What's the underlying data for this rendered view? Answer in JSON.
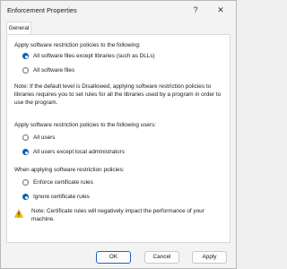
{
  "window": {
    "title": "Enforcement Properties",
    "help_glyph": "?",
    "close_glyph": "✕"
  },
  "tabs": [
    {
      "label": "General"
    }
  ],
  "section1": {
    "heading": "Apply software restriction policies to the following:",
    "options": [
      {
        "label": "All software files except libraries (such as DLLs)",
        "selected": true
      },
      {
        "label": "All software files",
        "selected": false
      }
    ]
  },
  "note": "Note:  If the default level is Disallowed, applying software restriction policies to libraries requires you to set rules for all the libraries used by a program in order to use the program.",
  "section2": {
    "heading": "Apply software restriction policies to the following users:",
    "options": [
      {
        "label": "All users",
        "selected": false
      },
      {
        "label": "All users except local administrators",
        "selected": true
      }
    ]
  },
  "section3": {
    "heading": "When applying software restriction policies:",
    "options": [
      {
        "label": "Enforce certificate rules",
        "selected": false
      },
      {
        "label": "Ignore certificate rules",
        "selected": true
      }
    ]
  },
  "warning": {
    "icon": "warning-icon",
    "text": "Note:  Certificate rules will negatively impact the performance of your machine."
  },
  "buttons": {
    "ok": "OK",
    "cancel": "Cancel",
    "apply": "Apply"
  },
  "colors": {
    "accent": "#0a5fb8",
    "warning": "#f2c200"
  }
}
